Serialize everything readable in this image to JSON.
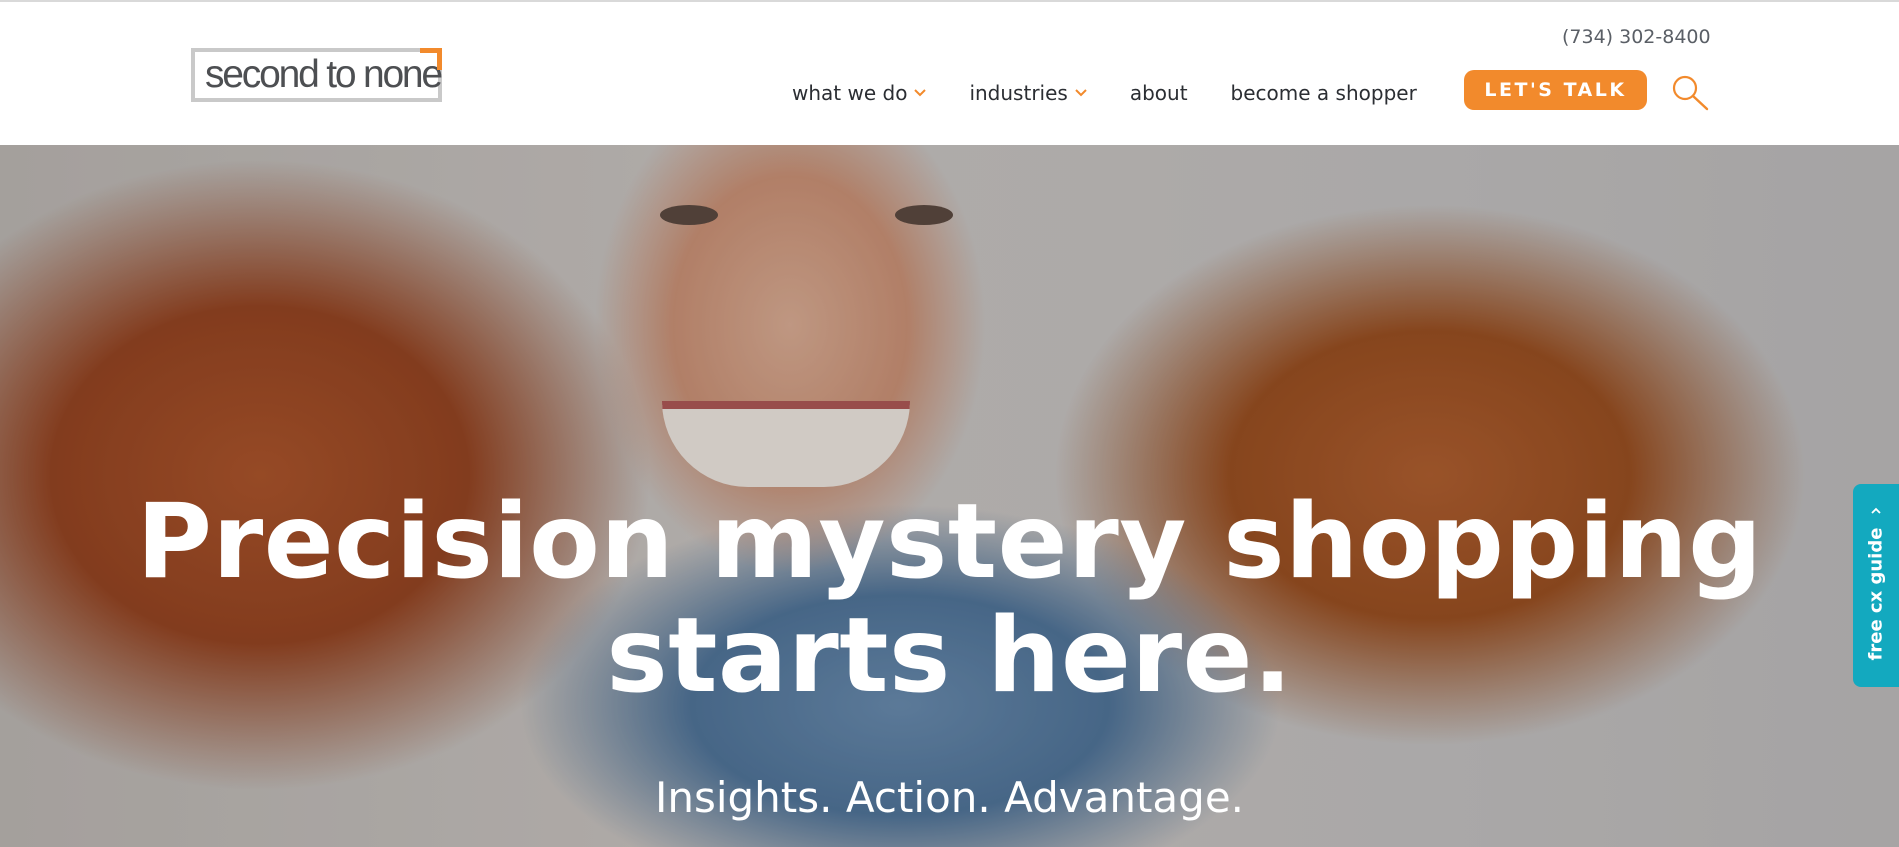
{
  "header": {
    "logo_text": "second to none",
    "phone": "(734) 302-8400",
    "nav": [
      {
        "label": "what we do",
        "has_dropdown": true
      },
      {
        "label": "industries",
        "has_dropdown": true
      },
      {
        "label": "about",
        "has_dropdown": false
      },
      {
        "label": "become a shopper",
        "has_dropdown": false
      }
    ],
    "cta_label": "LET'S TALK",
    "search_icon": "search-icon"
  },
  "hero": {
    "title": "Precision mystery shopping starts here.",
    "subtitle": "Insights. Action. Advantage."
  },
  "side_tab": {
    "label": "free cx guide",
    "icon": "chevron-up-icon"
  },
  "colors": {
    "accent_orange": "#f28a2c",
    "side_tab_teal": "#13a9bf",
    "nav_text": "#2b2e33"
  }
}
